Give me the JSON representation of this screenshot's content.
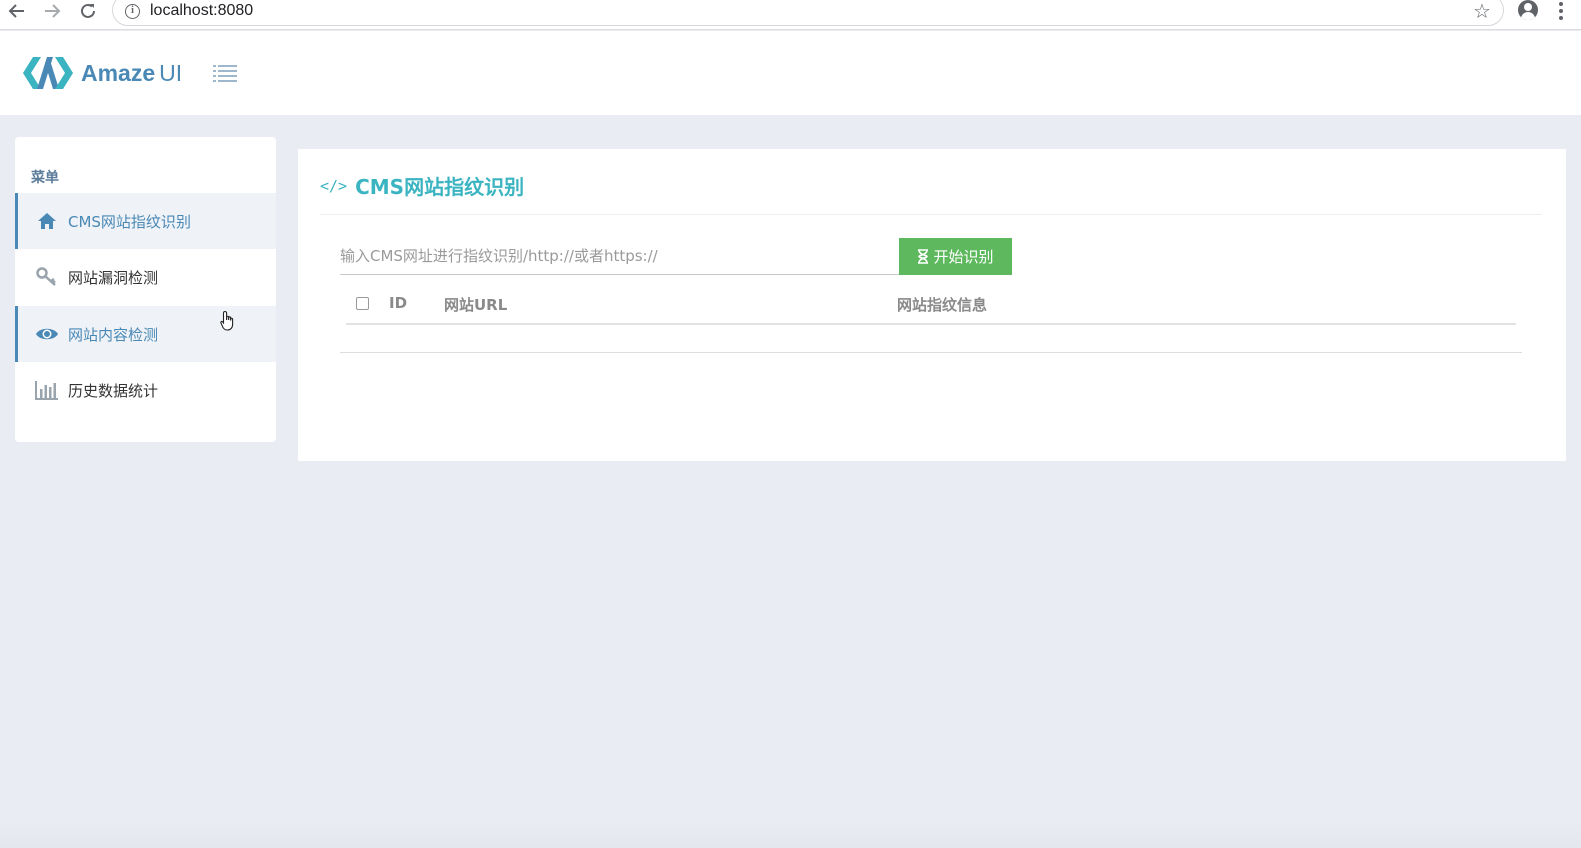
{
  "browser": {
    "url_host": "localhost",
    "url_port": ":8080"
  },
  "header": {
    "logo_bold": "Amaze",
    "logo_thin": "UI"
  },
  "sidebar": {
    "title": "菜单",
    "items": [
      {
        "label": "CMS网站指纹识别",
        "icon": "home-icon",
        "state": "active"
      },
      {
        "label": "网站漏洞检测",
        "icon": "key-icon",
        "state": "normal"
      },
      {
        "label": "网站内容检测",
        "icon": "eye-icon",
        "state": "hover"
      },
      {
        "label": "历史数据统计",
        "icon": "bar-chart-icon",
        "state": "normal"
      }
    ]
  },
  "main": {
    "title": "CMS网站指纹识别",
    "url_input": {
      "placeholder": "输入CMS网址进行指纹识别/http://或者https://",
      "value": ""
    },
    "start_button": "开始识别",
    "table": {
      "columns": [
        "ID",
        "网站URL",
        "网站指纹信息"
      ],
      "rows": []
    }
  },
  "colors": {
    "accent": "#4a88b5",
    "title": "#3bb4c1",
    "button": "#5eb95e",
    "background": "#e9ecf2"
  }
}
